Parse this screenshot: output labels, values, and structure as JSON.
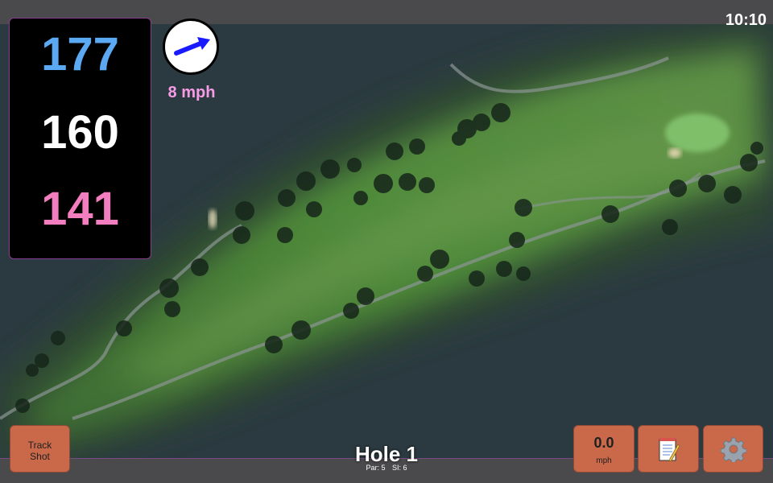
{
  "status": {
    "time": "10:10"
  },
  "distances": {
    "back": "177",
    "middle": "160",
    "front": "141"
  },
  "wind": {
    "speed": "8 mph",
    "direction_icon": "wind-arrow-icon"
  },
  "hole": {
    "title": "Hole 1",
    "par": "Par: 5",
    "si": "SI: 6"
  },
  "buttons": {
    "track_shot_line1": "Track",
    "track_shot_line2": "Shot",
    "speed_value": "0.0",
    "speed_unit": "mph",
    "notes_icon": "notepad-icon",
    "settings_icon": "gear-icon"
  },
  "colors": {
    "back_distance": "#5aa9f2",
    "middle_distance": "#ffffff",
    "front_distance": "#f27ec0",
    "wind_text": "#f79be6",
    "button": "#c9694a",
    "bar": "#4a4a4c",
    "water": "#2b3a40",
    "fairway": "#4f8a3a"
  }
}
